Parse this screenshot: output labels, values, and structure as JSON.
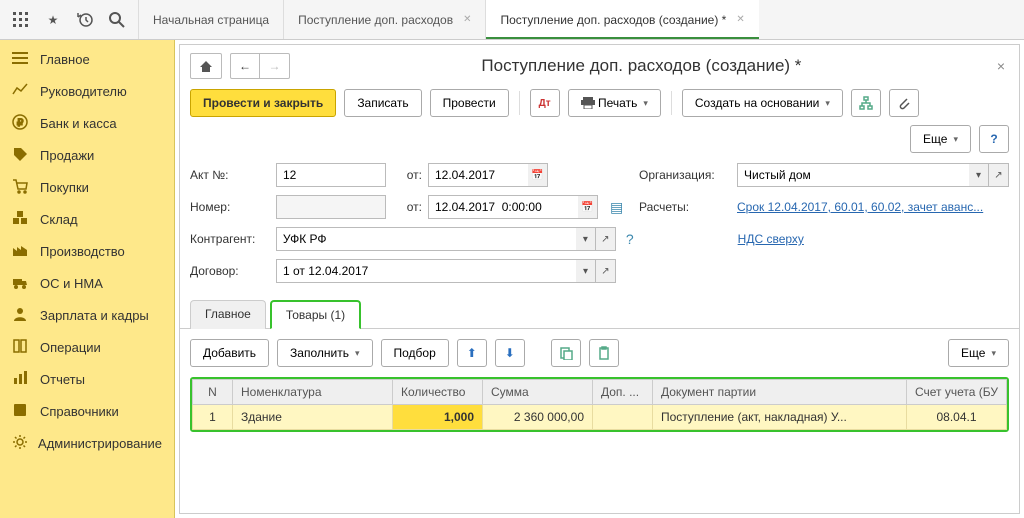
{
  "topbar": {
    "tabs": [
      {
        "label": "Начальная страница",
        "active": false,
        "closable": false
      },
      {
        "label": "Поступление доп. расходов",
        "active": false,
        "closable": true
      },
      {
        "label": "Поступление доп. расходов (создание) *",
        "active": true,
        "closable": true
      }
    ]
  },
  "sidebar": {
    "items": [
      {
        "label": "Главное"
      },
      {
        "label": "Руководителю"
      },
      {
        "label": "Банк и касса"
      },
      {
        "label": "Продажи"
      },
      {
        "label": "Покупки"
      },
      {
        "label": "Склад"
      },
      {
        "label": "Производство"
      },
      {
        "label": "ОС и НМА"
      },
      {
        "label": "Зарплата и кадры"
      },
      {
        "label": "Операции"
      },
      {
        "label": "Отчеты"
      },
      {
        "label": "Справочники"
      },
      {
        "label": "Администрирование"
      }
    ]
  },
  "page": {
    "title": "Поступление доп. расходов (создание) *"
  },
  "toolbar": {
    "post_close": "Провести и закрыть",
    "save": "Записать",
    "post": "Провести",
    "print": "Печать",
    "create_basis": "Создать на основании",
    "more": "Еще"
  },
  "form": {
    "act_label": "Акт №:",
    "act_no": "12",
    "ot1": "от:",
    "act_date": "12.04.2017",
    "nomer_label": "Номер:",
    "nomer": "",
    "ot2": "от:",
    "nomer_date": "12.04.2017  0:00:00",
    "org_label": "Организация:",
    "org": "Чистый дом",
    "calc_label": "Расчеты:",
    "calc_link": "Срок 12.04.2017, 60.01, 60.02, зачет аванс...",
    "contr_label": "Контрагент:",
    "contr": "УФК РФ",
    "vat_link": "НДС сверху",
    "dogovor_label": "Договор:",
    "dogovor": "1 от 12.04.2017"
  },
  "subtabs": {
    "main": "Главное",
    "goods": "Товары (1)"
  },
  "subtoolbar": {
    "add": "Добавить",
    "fill": "Заполнить",
    "select": "Подбор",
    "more": "Еще"
  },
  "table": {
    "headers": {
      "n": "N",
      "nomen": "Номенклатура",
      "qty": "Количество",
      "sum": "Сумма",
      "dop": "Доп. ...",
      "doc": "Документ партии",
      "acct": "Счет учета (БУ"
    },
    "rows": [
      {
        "n": "1",
        "nomen": "Здание",
        "qty": "1,000",
        "sum": "2 360 000,00",
        "dop": "",
        "doc": "Поступление (акт, накладная) У...",
        "acct": "08.04.1"
      }
    ]
  }
}
